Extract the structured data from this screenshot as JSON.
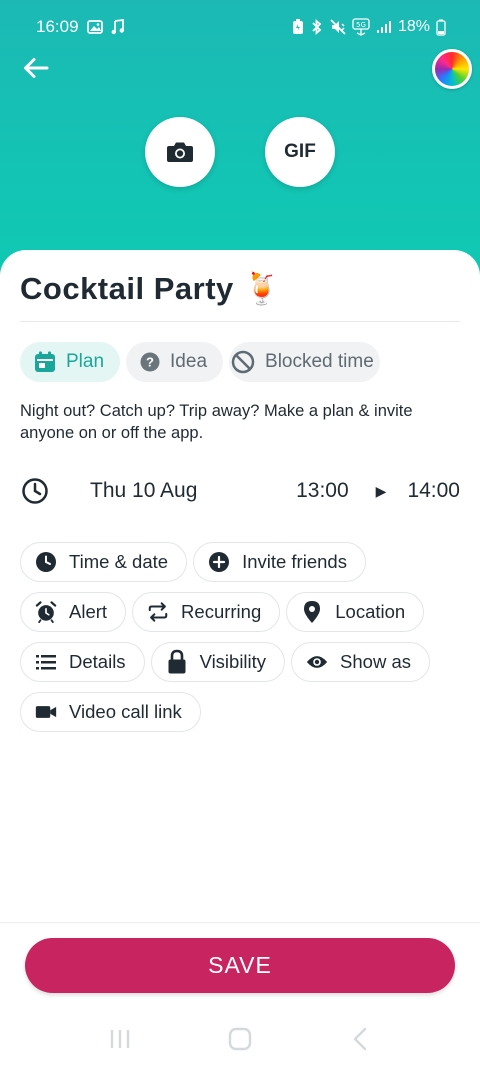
{
  "status_bar": {
    "time": "16:09",
    "battery": "18%",
    "icons": [
      "image-icon",
      "music-icon",
      "battery-saver-icon",
      "bluetooth-icon",
      "mute-icon",
      "5g-icon",
      "signal-icon",
      "battery-icon"
    ]
  },
  "header": {
    "gif_label": "GIF",
    "colors": {
      "gradient_top": "#1cb9b4",
      "gradient_bottom": "#0fcab2"
    }
  },
  "event": {
    "title": "Cocktail Party 🍹"
  },
  "types": [
    {
      "label": "Plan",
      "icon": "calendar-icon",
      "active": true
    },
    {
      "label": "Idea",
      "icon": "question-icon",
      "active": false
    },
    {
      "label": "Blocked time",
      "icon": "blocked-icon",
      "active": false
    }
  ],
  "description": "Night out? Catch up? Trip away? Make a plan & invite anyone on or off the app.",
  "schedule": {
    "date": "Thu 10 Aug",
    "start": "13:00",
    "end": "14:00"
  },
  "options": [
    {
      "label": "Time & date",
      "icon": "clock-icon"
    },
    {
      "label": "Invite friends",
      "icon": "add-circle-icon"
    },
    {
      "label": "Alert",
      "icon": "alarm-icon"
    },
    {
      "label": "Recurring",
      "icon": "repeat-icon"
    },
    {
      "label": "Location",
      "icon": "location-pin-icon"
    },
    {
      "label": "Details",
      "icon": "list-icon"
    },
    {
      "label": "Visibility",
      "icon": "lock-icon"
    },
    {
      "label": "Show as",
      "icon": "eye-icon"
    },
    {
      "label": "Video call link",
      "icon": "video-camera-icon"
    }
  ],
  "save_label": "SAVE",
  "colors": {
    "accent": "#1aa79b",
    "save": "#c8245f"
  }
}
